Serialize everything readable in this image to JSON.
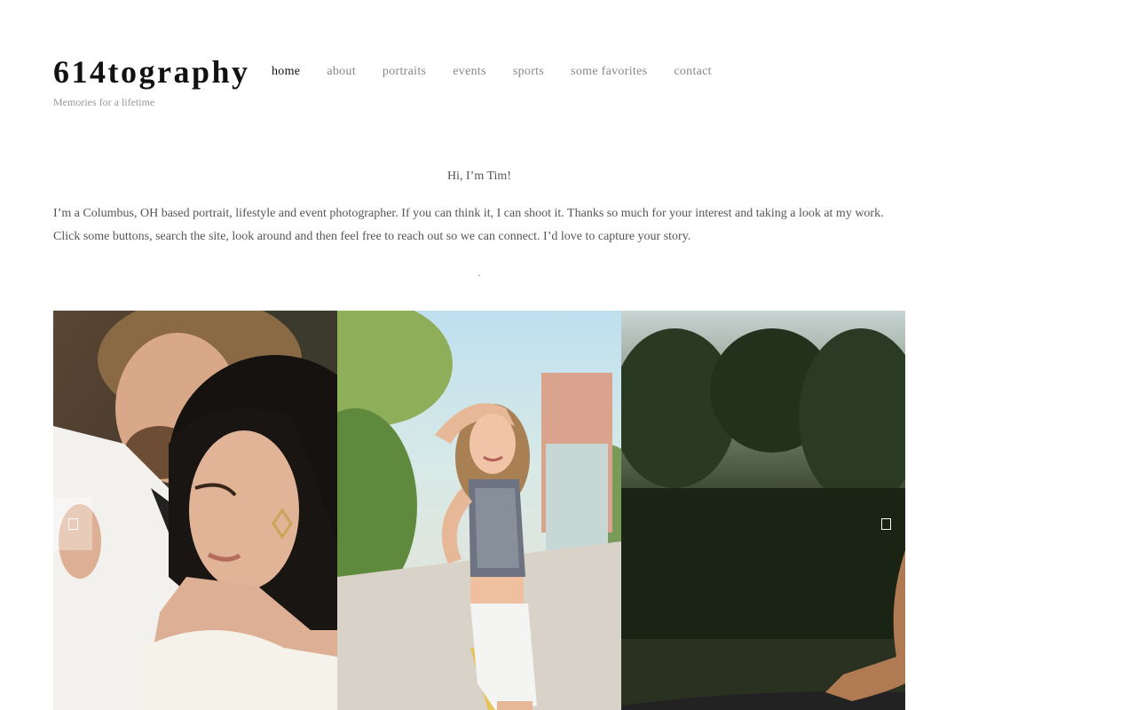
{
  "site": {
    "title": "614tography",
    "tagline": "Memories for a lifetime"
  },
  "nav": {
    "items": [
      {
        "label": "home",
        "active": true
      },
      {
        "label": "about"
      },
      {
        "label": "portraits"
      },
      {
        "label": "events"
      },
      {
        "label": "sports"
      },
      {
        "label": "some favorites"
      },
      {
        "label": "contact"
      }
    ]
  },
  "intro": {
    "greeting": "Hi, I’m Tim!",
    "body": "I’m a Columbus, OH based portrait, lifestyle and event photographer. If you can think it, I can shoot it. Thanks so much for your interest and taking a look at my work.  Click some buttons, search the site, look around and then feel free to reach out so we can connect.  I’d love to capture your story.",
    "separator": "."
  },
  "slider": {
    "icons": {
      "prev": "prev-arrow-icon",
      "next": "next-arrow-icon"
    }
  }
}
